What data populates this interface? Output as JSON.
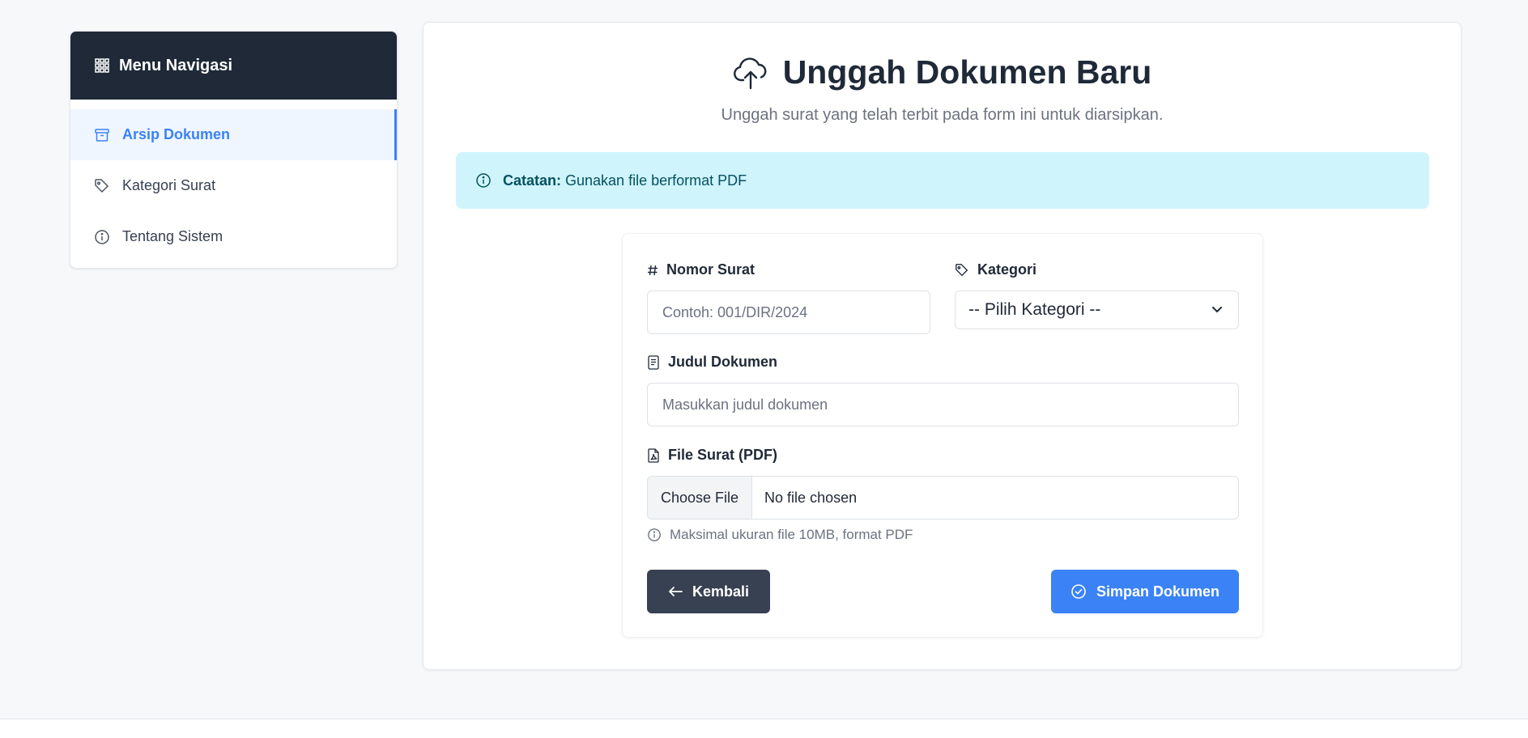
{
  "sidebar": {
    "title": "Menu Navigasi",
    "items": [
      {
        "label": "Arsip Dokumen",
        "icon": "archive-icon",
        "active": true
      },
      {
        "label": "Kategori Surat",
        "icon": "tag-icon",
        "active": false
      },
      {
        "label": "Tentang Sistem",
        "icon": "info-icon",
        "active": false
      }
    ]
  },
  "page": {
    "title": "Unggah Dokumen Baru",
    "subtitle": "Unggah surat yang telah terbit pada form ini untuk diarsipkan.",
    "icon": "cloud-upload-icon"
  },
  "alert": {
    "bold": "Catatan:",
    "text": "Gunakan file berformat PDF"
  },
  "form": {
    "nomor_surat": {
      "label": "Nomor Surat",
      "placeholder": "Contoh: 001/DIR/2024",
      "value": ""
    },
    "kategori": {
      "label": "Kategori",
      "selected": "-- Pilih Kategori --"
    },
    "judul": {
      "label": "Judul Dokumen",
      "placeholder": "Masukkan judul dokumen",
      "value": ""
    },
    "file": {
      "label": "File Surat (PDF)",
      "button": "Choose File",
      "status": "No file chosen",
      "help": "Maksimal ukuran file 10MB, format PDF"
    },
    "back_button": "Kembali",
    "save_button": "Simpan Dokumen"
  },
  "colors": {
    "sidebar_header": "#1f2937",
    "accent": "#3b82f6",
    "alert_bg": "#cff4fc",
    "back_button": "#374151"
  }
}
